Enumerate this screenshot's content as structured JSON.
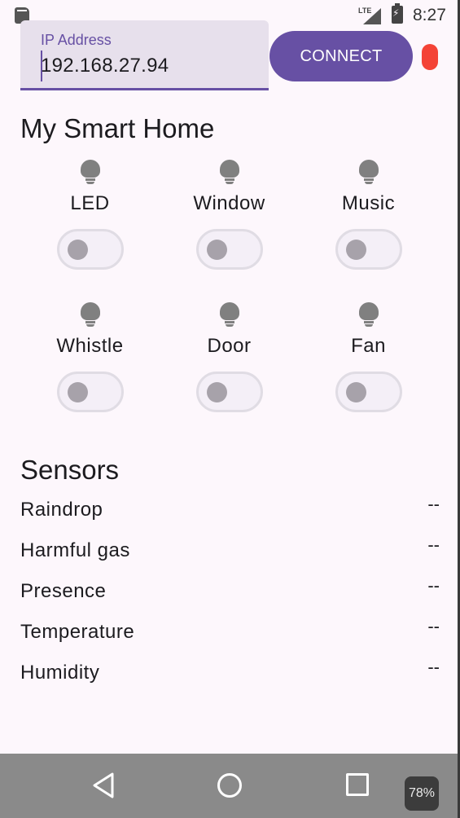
{
  "status_bar": {
    "network": "LTE",
    "time": "8:27"
  },
  "connection": {
    "ip_label": "IP Address",
    "ip_value": "192.168.27.94",
    "connect_label": "CONNECT",
    "status_color": "#f44336"
  },
  "title": "My Smart Home",
  "devices": [
    {
      "label": "LED",
      "on": false,
      "icon": "lightbulb-icon"
    },
    {
      "label": "Window",
      "on": false,
      "icon": "lightbulb-icon"
    },
    {
      "label": "Music",
      "on": false,
      "icon": "lightbulb-icon"
    },
    {
      "label": "Whistle",
      "on": false,
      "icon": "lightbulb-icon"
    },
    {
      "label": "Door",
      "on": false,
      "icon": "lightbulb-icon"
    },
    {
      "label": "Fan",
      "on": false,
      "icon": "lightbulb-icon"
    }
  ],
  "sensors_title": "Sensors",
  "sensors": [
    {
      "name": "Raindrop",
      "value": "--"
    },
    {
      "name": "Harmful gas",
      "value": "--"
    },
    {
      "name": "Presence",
      "value": "--"
    },
    {
      "name": "Temperature",
      "value": "--"
    },
    {
      "name": "Humidity",
      "value": "--"
    }
  ],
  "nav": {
    "zoom": "78%"
  },
  "colors": {
    "accent": "#6750a4",
    "background": "#fdf7fc"
  }
}
